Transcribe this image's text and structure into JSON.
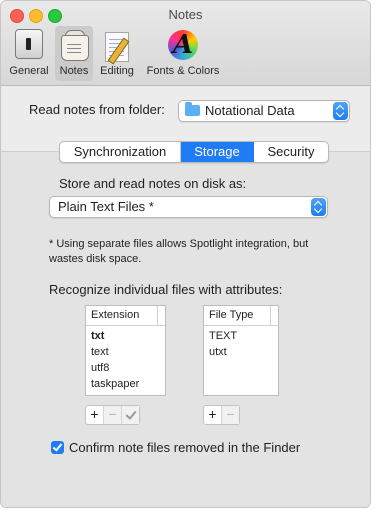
{
  "window": {
    "title": "Notes"
  },
  "toolbar": {
    "items": [
      {
        "label": "General",
        "icon": "general-switch-icon",
        "selected": false
      },
      {
        "label": "Notes",
        "icon": "notes-bag-icon",
        "selected": true
      },
      {
        "label": "Editing",
        "icon": "notepad-pencil-icon",
        "selected": false
      },
      {
        "label": "Fonts & Colors",
        "icon": "color-wheel-icon",
        "selected": false
      }
    ]
  },
  "folder": {
    "label": "Read notes from folder:",
    "value": "Notational Data"
  },
  "tabs": [
    {
      "label": "Synchronization",
      "selected": false
    },
    {
      "label": "Storage",
      "selected": true
    },
    {
      "label": "Security",
      "selected": false
    }
  ],
  "storage": {
    "format_label": "Store and read notes on disk as:",
    "format_value": "Plain Text Files *",
    "footnote": "* Using separate files allows Spotlight integration, but wastes disk space.",
    "recognize_label": "Recognize individual files with attributes:",
    "extension_table": {
      "header": "Extension",
      "rows": [
        "txt",
        "text",
        "utf8",
        "taskpaper"
      ]
    },
    "filetype_table": {
      "header": "File Type",
      "rows": [
        "TEXT",
        "utxt"
      ]
    },
    "confirm_label": "Confirm note files removed in the Finder",
    "confirm_checked": true
  },
  "colors": {
    "accent": "#1f7cf5"
  }
}
